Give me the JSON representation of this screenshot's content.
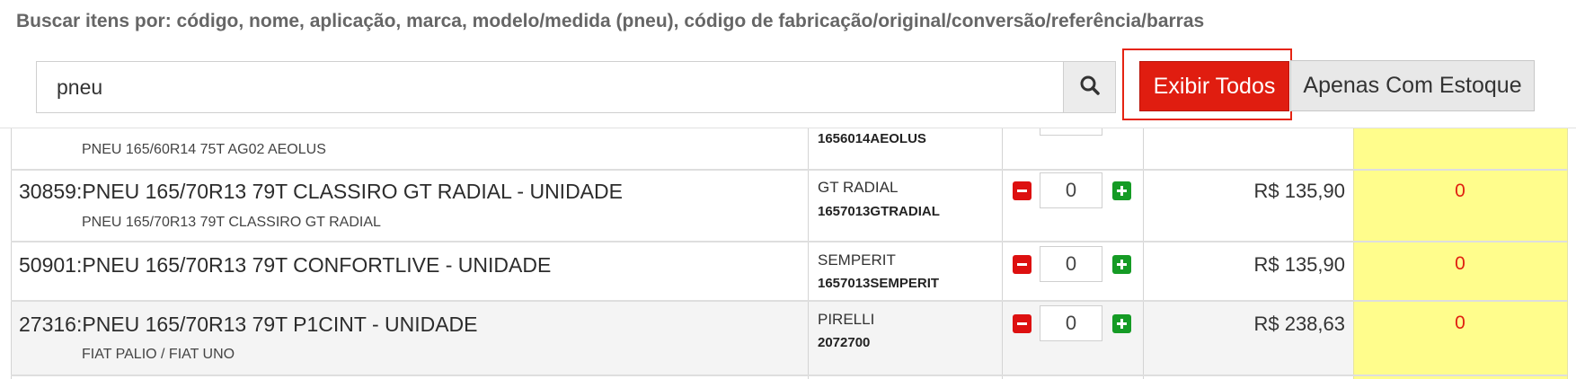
{
  "search": {
    "label": "Buscar itens por: código, nome, aplicação, marca, modelo/medida (pneu), código de fabricação/original/conversão/referência/barras",
    "value": "pneu",
    "search_icon": "search-icon"
  },
  "filters": {
    "show_all_label": "Exibir Todos",
    "in_stock_label": "Apenas Com Estoque",
    "active_color": "#e01d10"
  },
  "items": [
    {
      "title": "",
      "subtitle": "PNEU 165/60R14 75T AG02 AEOLUS",
      "brand": "",
      "code": "1656014AEOLUS",
      "quantity": "",
      "price": "",
      "stock": ""
    },
    {
      "title": "30859:PNEU 165/70R13 79T CLASSIRO GT RADIAL - UNIDADE",
      "subtitle": "PNEU 165/70R13 79T CLASSIRO GT RADIAL",
      "brand": "GT RADIAL",
      "code": "1657013GTRADIAL",
      "quantity": "0",
      "price": "R$ 135,90",
      "stock": "0"
    },
    {
      "title": "50901:PNEU 165/70R13 79T CONFORTLIVE - UNIDADE",
      "subtitle": "",
      "brand": "SEMPERIT",
      "code": "1657013SEMPERIT",
      "quantity": "0",
      "price": "R$ 135,90",
      "stock": "0"
    },
    {
      "title": "27316:PNEU 165/70R13 79T P1CINT - UNIDADE",
      "subtitle": "FIAT PALIO / FIAT UNO",
      "brand": "PIRELLI",
      "code": "2072700",
      "quantity": "0",
      "price": "R$ 238,63",
      "stock": "0"
    }
  ],
  "colors": {
    "stock_column_bg": "#fffd8c",
    "stock_text": "#e02010",
    "minus_button": "#dd1010",
    "plus_button": "#159b25"
  }
}
